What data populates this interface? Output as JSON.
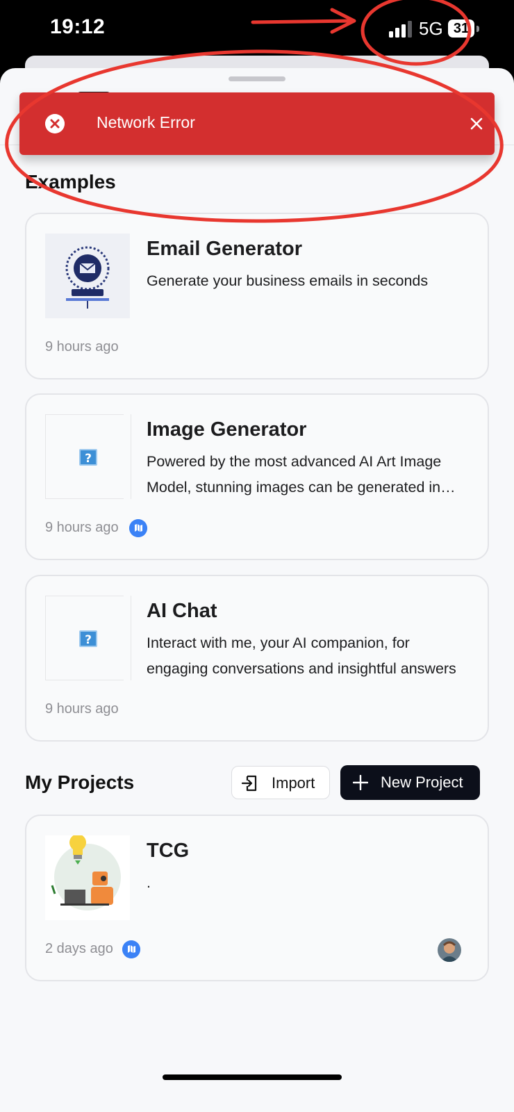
{
  "status_bar": {
    "time": "19:12",
    "network": "5G",
    "battery": "31"
  },
  "toast": {
    "message": "Network Error",
    "close_icon": "close-icon",
    "error_icon": "error-circle-icon",
    "color": "#d32f2f"
  },
  "examples": {
    "title": "Examples",
    "cards": [
      {
        "title": "Email Generator",
        "description": "Generate your business emails in seconds",
        "time": "9 hours ago"
      },
      {
        "title": "Image Generator",
        "description": "Powered by the most advanced AI Art Image Model, stunning images can be generated in seconds",
        "time": "9 hours ago"
      },
      {
        "title": "AI Chat",
        "description": "Interact with me, your AI companion, for engaging conversations and insightful answers",
        "time": "9 hours ago"
      }
    ]
  },
  "projects": {
    "title": "My Projects",
    "import_label": "Import",
    "new_project_label": "New Project",
    "cards": [
      {
        "title": "TCG",
        "description": ".",
        "time": "2 days ago"
      }
    ]
  },
  "colors": {
    "accent": "#0c0f1a",
    "badge": "#3b82f6",
    "annotation": "#e8372f"
  }
}
